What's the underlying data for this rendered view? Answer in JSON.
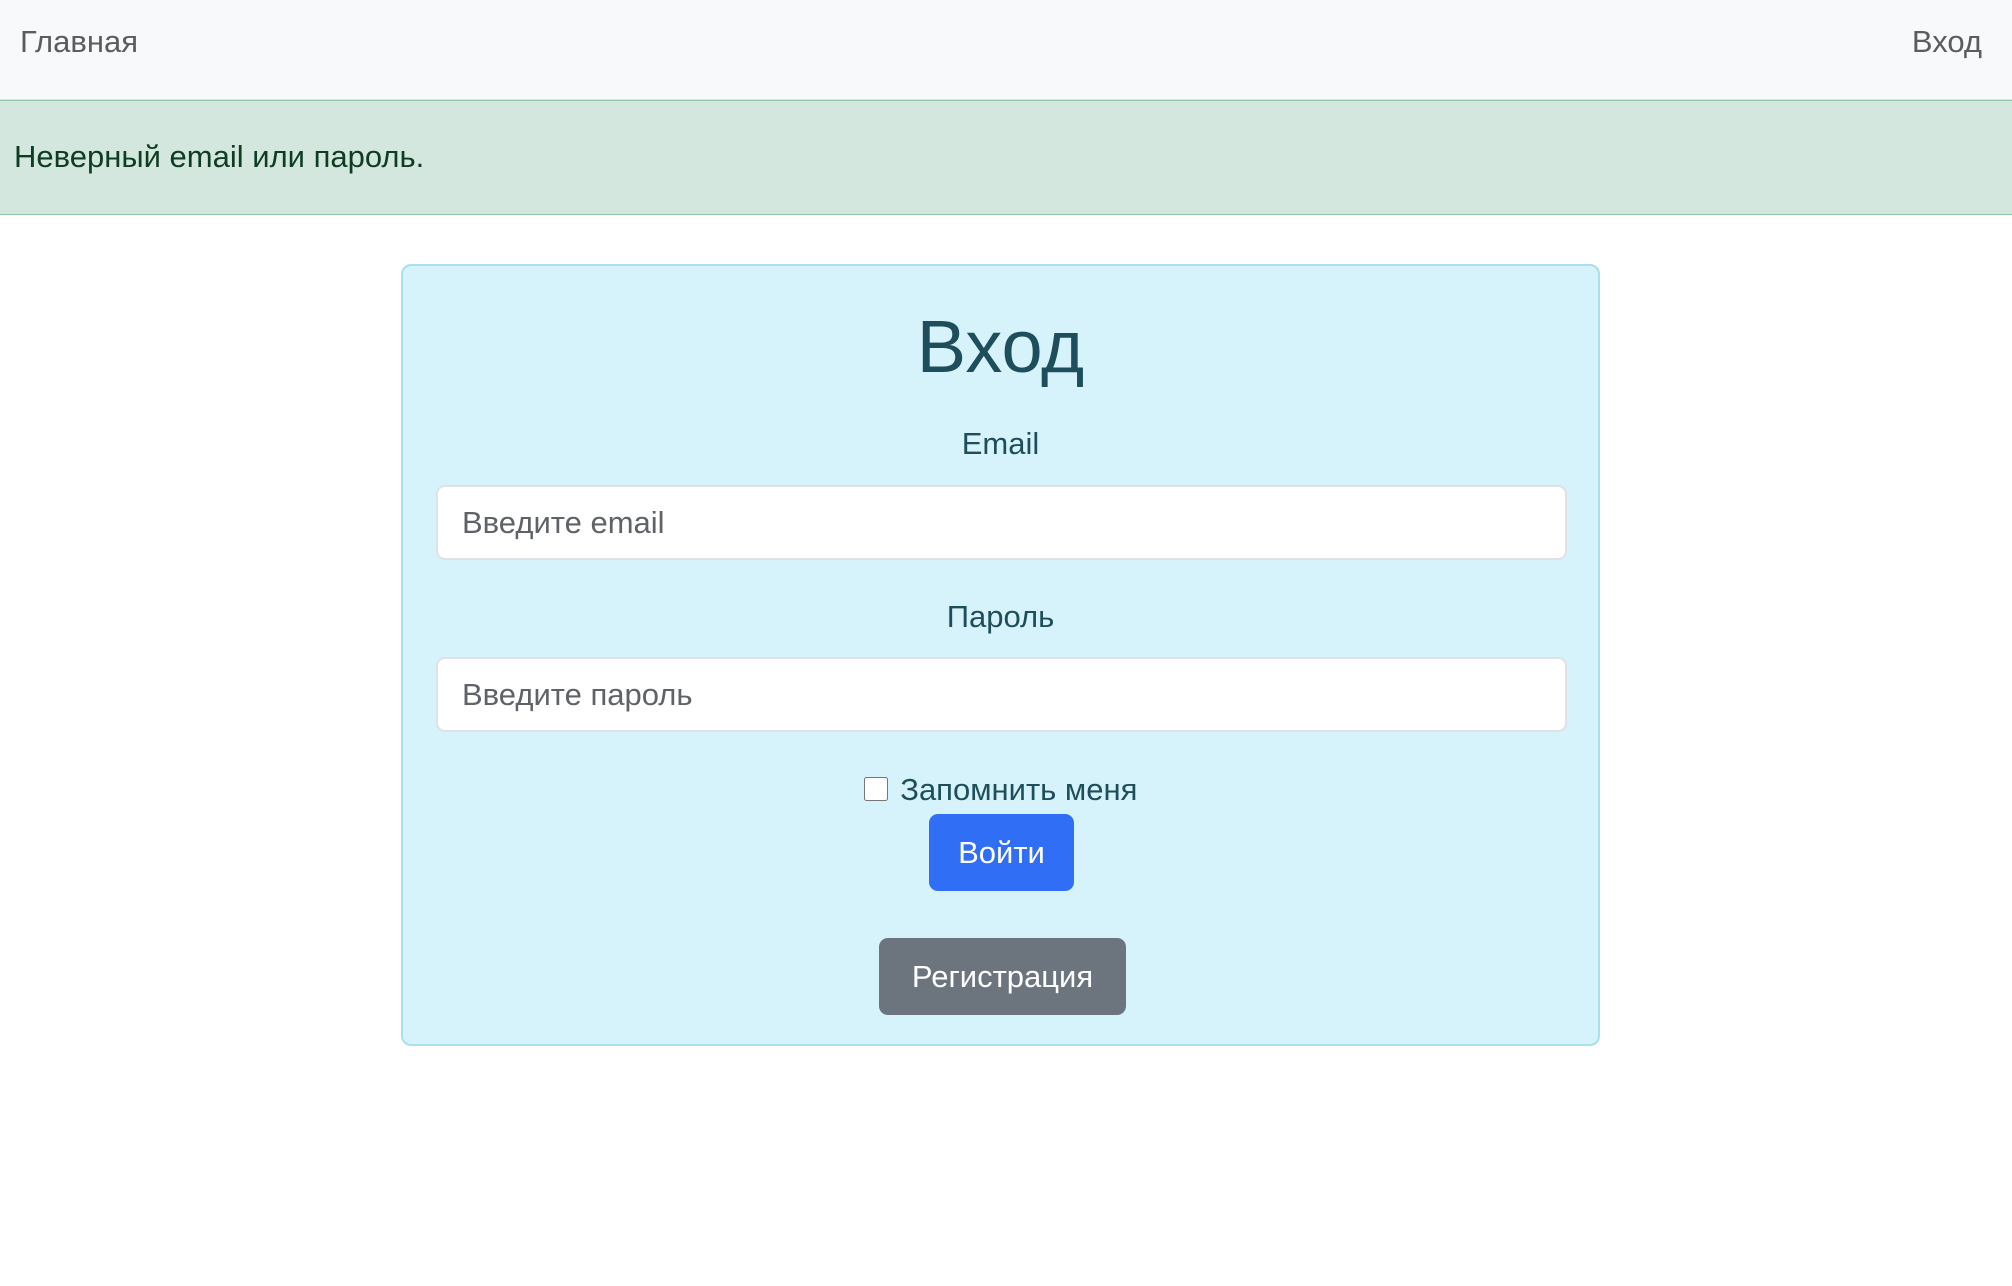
{
  "navbar": {
    "home_label": "Главная",
    "login_label": "Вход"
  },
  "alert": {
    "message": "Неверный email или пароль."
  },
  "login_form": {
    "title": "Вход",
    "email_label": "Email",
    "email_placeholder": "Введите email",
    "email_value": "",
    "password_label": "Пароль",
    "password_placeholder": "Введите пароль",
    "password_value": "",
    "remember_label": "Запомнить меня",
    "remember_checked": false,
    "submit_label": "Войти",
    "register_label": "Регистрация"
  },
  "colors": {
    "navbar_bg": "#f8f9fa",
    "alert_bg": "#d4e7df",
    "card_bg": "#d6f2fa",
    "primary_button": "#2f6ef5",
    "secondary_button": "#6c757d",
    "title_text": "#1e4e5c"
  }
}
